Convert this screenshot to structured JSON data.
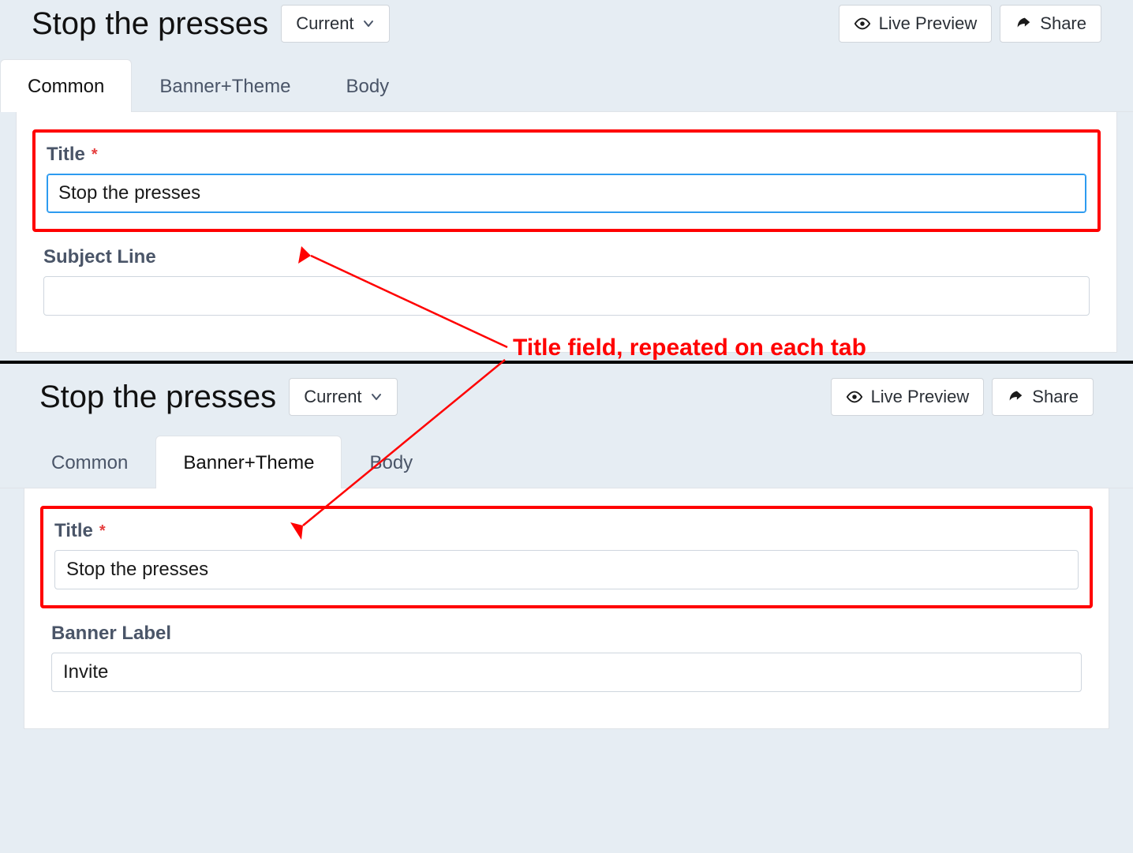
{
  "panel1": {
    "title": "Stop the presses",
    "version_button": "Current",
    "live_preview": "Live Preview",
    "share": "Share",
    "tabs": {
      "common": "Common",
      "banner": "Banner+Theme",
      "body": "Body"
    },
    "fields": {
      "title_label": "Title",
      "title_value": "Stop the presses",
      "subject_label": "Subject Line",
      "subject_value": ""
    }
  },
  "panel2": {
    "title": "Stop the presses",
    "version_button": "Current",
    "live_preview": "Live Preview",
    "share": "Share",
    "tabs": {
      "common": "Common",
      "banner": "Banner+Theme",
      "body": "Body"
    },
    "fields": {
      "title_label": "Title",
      "title_value": "Stop the presses",
      "banner_label": "Banner Label",
      "banner_value": "Invite"
    }
  },
  "annotation": "Title field, repeated on each tab",
  "required_marker": "*"
}
